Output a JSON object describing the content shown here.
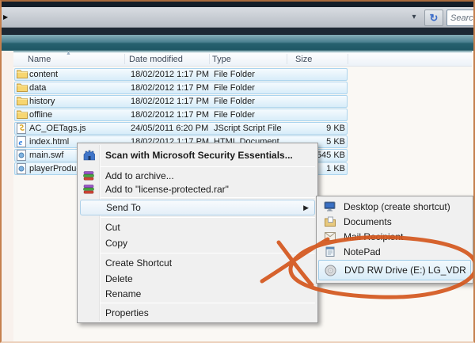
{
  "window": {
    "address_value": "",
    "search_placeholder": "Search"
  },
  "file_list": {
    "columns": [
      "Name",
      "Date modified",
      "Type",
      "Size"
    ],
    "sort_column": "Name",
    "rows": [
      {
        "name": "content",
        "date": "18/02/2012 1:17 PM",
        "type": "File Folder",
        "size": "",
        "icon": "folder-icon"
      },
      {
        "name": "data",
        "date": "18/02/2012 1:17 PM",
        "type": "File Folder",
        "size": "",
        "icon": "folder-icon"
      },
      {
        "name": "history",
        "date": "18/02/2012 1:17 PM",
        "type": "File Folder",
        "size": "",
        "icon": "folder-icon"
      },
      {
        "name": "offline",
        "date": "18/02/2012 1:17 PM",
        "type": "File Folder",
        "size": "",
        "icon": "folder-icon"
      },
      {
        "name": "AC_OETags.js",
        "date": "24/05/2011 6:20 PM",
        "type": "JScript Script File",
        "size": "9 KB",
        "icon": "jscript-file-icon"
      },
      {
        "name": "index.html",
        "date": "18/02/2012 1:17 PM",
        "type": "HTML Document",
        "size": "5 KB",
        "icon": "html-file-icon"
      },
      {
        "name": "main.swf",
        "date": "",
        "type": "",
        "size": "545 KB",
        "icon": "swf-file-icon"
      },
      {
        "name": "playerProduc",
        "date": "",
        "type": "",
        "size": "1 KB",
        "icon": "swf-file-icon"
      }
    ]
  },
  "context_menu": {
    "items": [
      {
        "label": "Scan with Microsoft Security Essentials...",
        "icon": "mse-shield-icon",
        "bold": true
      },
      {
        "label": "Add to archive...",
        "icon": "winrar-icon"
      },
      {
        "label": "Add to \"license-protected.rar\"",
        "icon": "winrar-icon"
      },
      {
        "label": "Send To",
        "highlighted": true,
        "has_submenu": true
      },
      {
        "label": "Cut"
      },
      {
        "label": "Copy"
      },
      {
        "label": "Create Shortcut"
      },
      {
        "label": "Delete"
      },
      {
        "label": "Rename"
      },
      {
        "label": "Properties"
      }
    ]
  },
  "send_to_submenu": {
    "items": [
      {
        "label": "Desktop (create shortcut)",
        "icon": "desktop-icon"
      },
      {
        "label": "Documents",
        "icon": "documents-icon"
      },
      {
        "label": "Mail Recipient",
        "icon": "mail-recipient-icon"
      },
      {
        "label": "NotePad",
        "icon": "notepad-icon"
      },
      {
        "label": "DVD RW Drive (E:) LG_VDR",
        "icon": "dvd-drive-icon",
        "highlighted": true
      }
    ]
  },
  "annotation": {
    "shape": "ellipse-with-x",
    "color": "#d4571d",
    "target": "DVD RW Drive (E:) LG_VDR"
  }
}
